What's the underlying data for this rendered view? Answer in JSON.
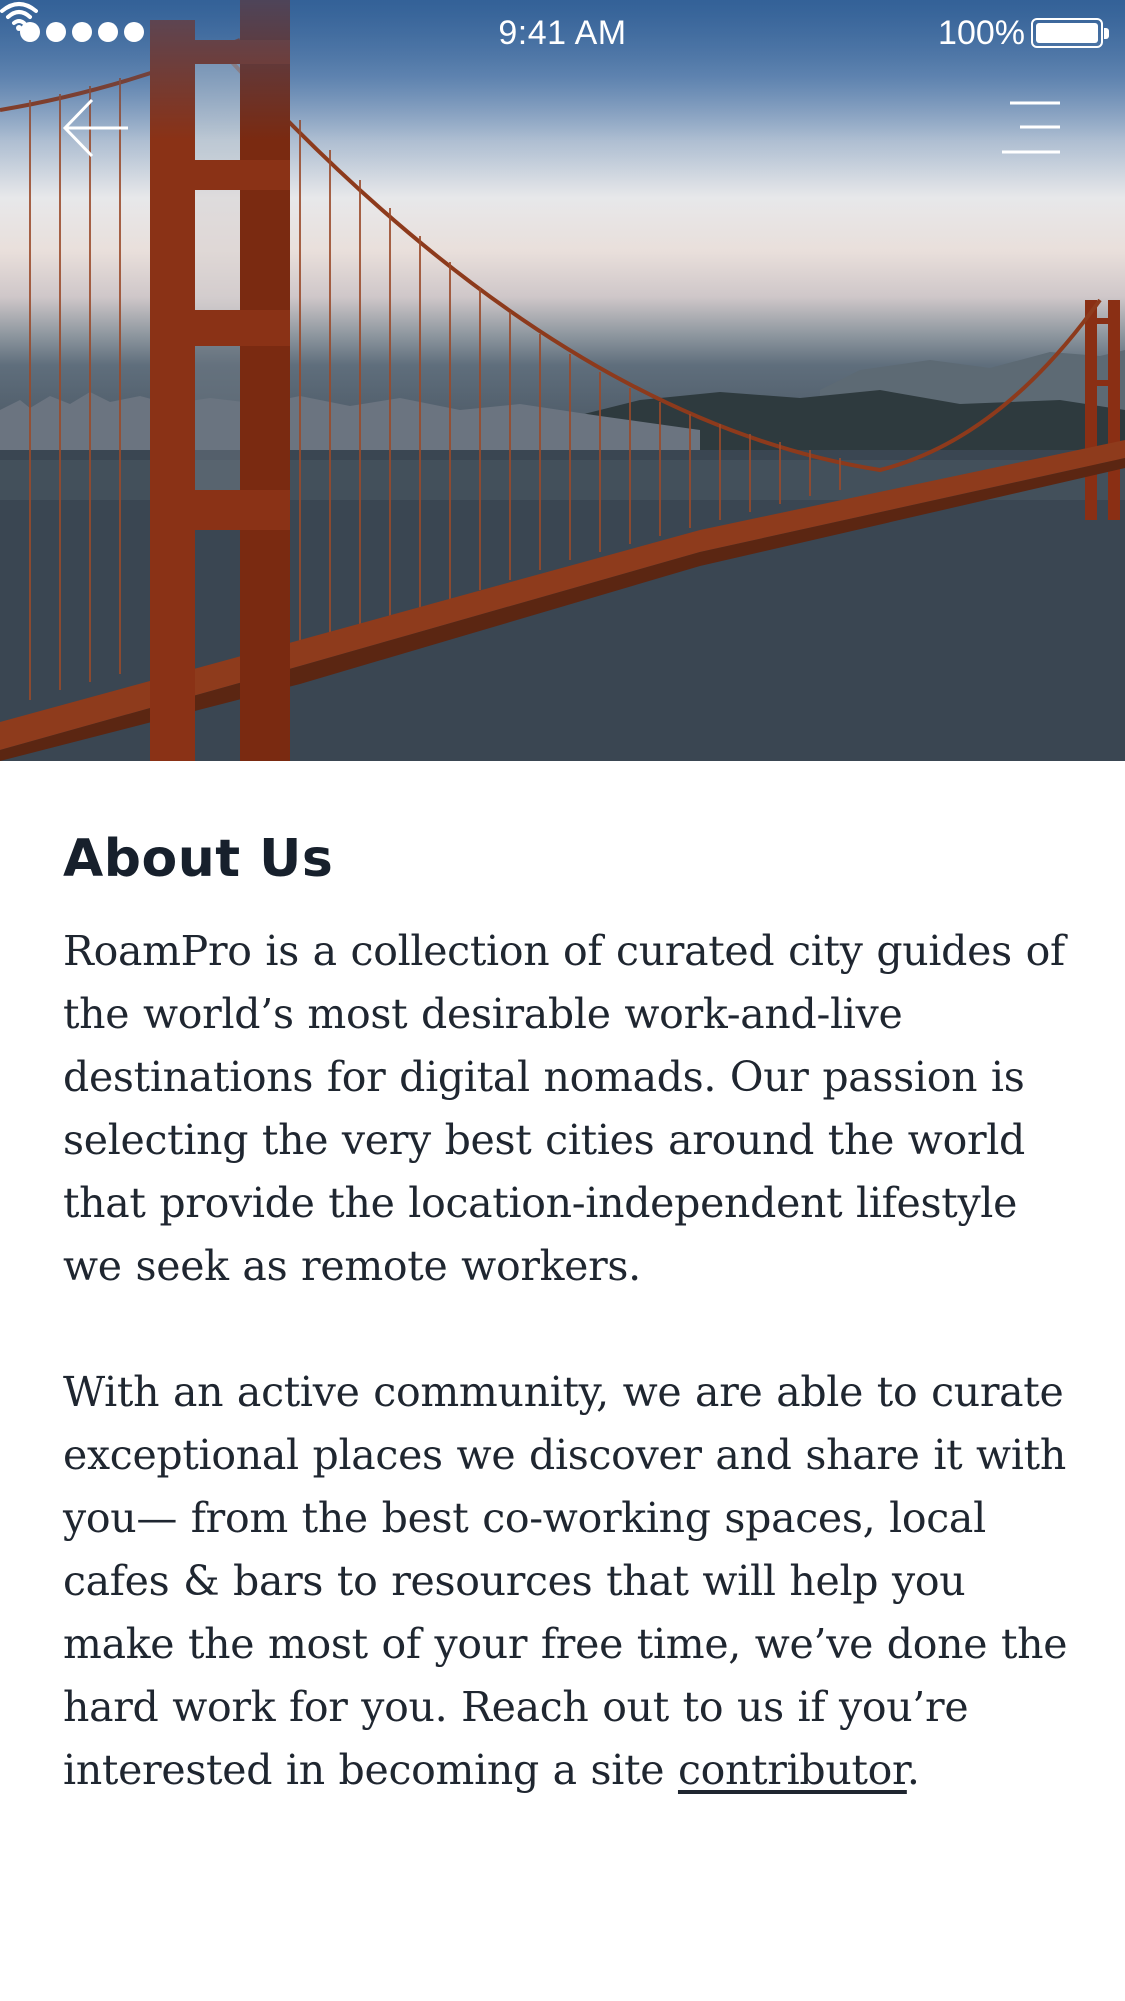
{
  "status_bar": {
    "time": "9:41 AM",
    "battery_percent": "100%",
    "signal_bars": 5,
    "icons": [
      "signal-icon",
      "wifi-icon",
      "battery-icon"
    ]
  },
  "header": {
    "back_icon": "arrow-left-icon",
    "menu_icon": "hamburger-menu-icon",
    "hero_image": "golden-gate-bridge-photo"
  },
  "content": {
    "title": "About Us",
    "paragraph_1": "RoamPro is a collection of curated city guides of the world’s most desirable work-and-live destinations for digital nomads.  Our passion is selecting the very best cities around the world that provide the location-independent lifestyle we seek as remote workers.",
    "paragraph_2_text": "With an active community, we are able to curate exceptional places we discover and share it with you— from the best co-working spaces, local cafes & bars to resources that will help you make the most of your free time, we’ve done the hard work for you.  Reach out to us if you’re interested in becoming a site ",
    "paragraph_2_link": "contributor",
    "paragraph_2_end": "."
  },
  "colors": {
    "title": "#17202c",
    "body_text": "#1f2630",
    "bridge": "#9a3d1e",
    "water": "#3a4652"
  }
}
